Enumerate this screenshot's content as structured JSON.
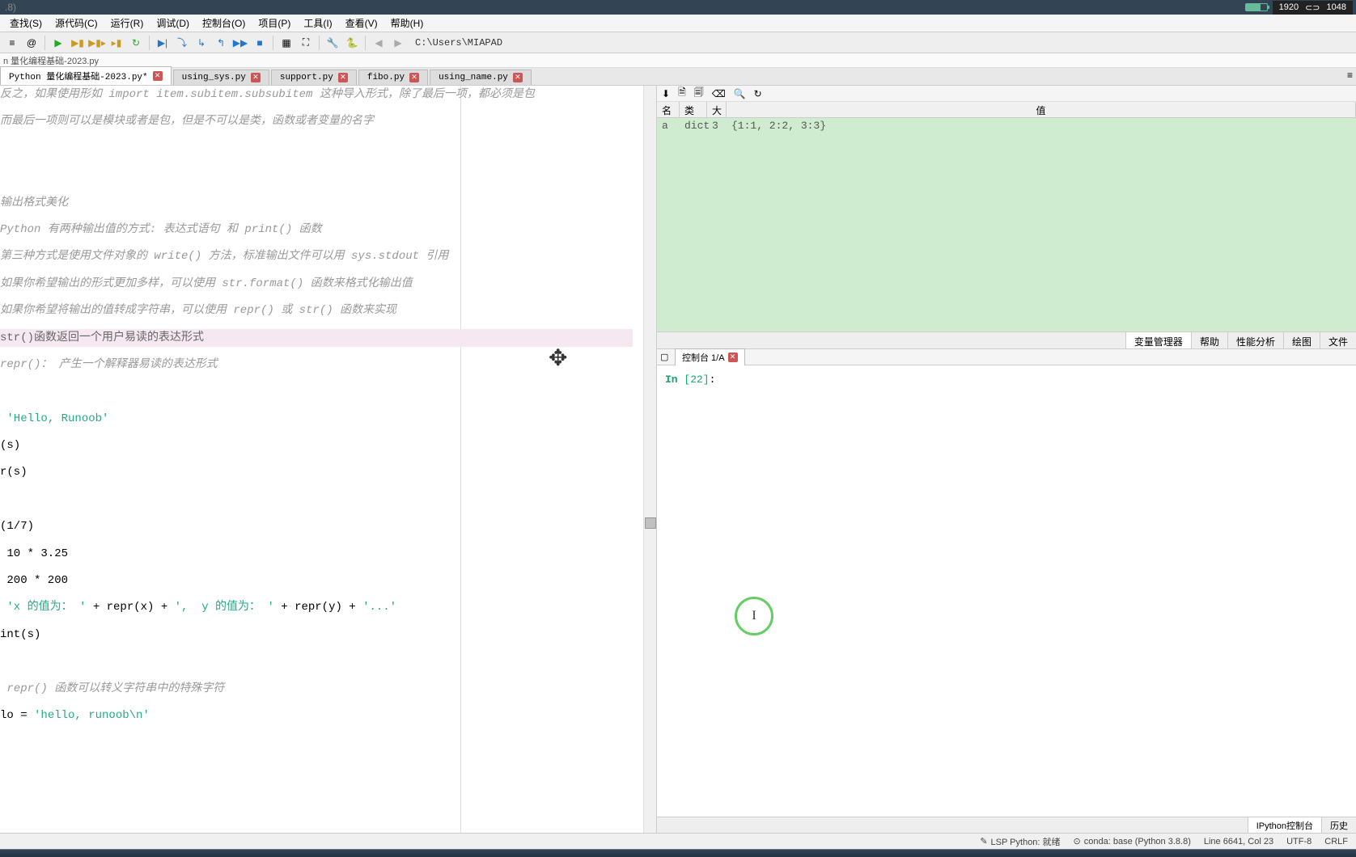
{
  "titlebar": {
    "text": ".8)",
    "resolution_w": "1920",
    "resolution_h": "1048"
  },
  "menu": {
    "find": "查找(S)",
    "source": "源代码(C)",
    "run": "运行(R)",
    "debug": "调试(D)",
    "console": "控制台(O)",
    "project": "项目(P)",
    "tools": "工具(I)",
    "view": "查看(V)",
    "help": "帮助(H)"
  },
  "toolbar": {
    "path": "C:\\Users\\MIAPAD"
  },
  "breadcrumb": "n 量化编程基础-2023.py",
  "tabs": [
    {
      "label": "Python 量化编程基础-2023.py*",
      "active": true
    },
    {
      "label": "using_sys.py",
      "active": false
    },
    {
      "label": "support.py",
      "active": false
    },
    {
      "label": "fibo.py",
      "active": false
    },
    {
      "label": "using_name.py",
      "active": false
    }
  ],
  "editor": {
    "lines": [
      {
        "t": "comment",
        "text": "反之，如果使用形如 import item.subitem.subsubitem 这种导入形式，除了最后一项，都必须是包"
      },
      {
        "t": "comment",
        "text": "而最后一项则可以是模块或者是包，但是不可以是类，函数或者变量的名字"
      },
      {
        "t": "blank"
      },
      {
        "t": "blank"
      },
      {
        "t": "comment",
        "text": "输出格式美化"
      },
      {
        "t": "comment",
        "text": "Python 有两种输出值的方式: 表达式语句 和 print() 函数"
      },
      {
        "t": "comment",
        "text": "第三种方式是使用文件对象的 write() 方法，标准输出文件可以用 sys.stdout 引用"
      },
      {
        "t": "comment",
        "text": "如果你希望输出的形式更加多样，可以使用 str.format() 函数来格式化输出值"
      },
      {
        "t": "comment",
        "text": "如果你希望将输出的值转成字符串，可以使用 repr() 或 str() 函数来实现"
      },
      {
        "t": "highlight",
        "text": "str()函数返回一个用户易读的表达形式"
      },
      {
        "t": "comment",
        "text": "repr()： 产生一个解释器易读的表达形式"
      },
      {
        "t": "blank"
      },
      {
        "t": "code-str",
        "prefix": " ",
        "string": "'Hello, Runoob'"
      },
      {
        "t": "code",
        "text": "(s)"
      },
      {
        "t": "code",
        "text": "r(s)"
      },
      {
        "t": "blank"
      },
      {
        "t": "code",
        "text": "(1/7)"
      },
      {
        "t": "code",
        "text": " 10 * 3.25"
      },
      {
        "t": "code",
        "text": " 200 * 200"
      },
      {
        "t": "code-mix",
        "parts": [
          {
            "k": "plain",
            "v": " "
          },
          {
            "k": "str",
            "v": "'x 的值为： '"
          },
          {
            "k": "plain",
            "v": " + repr(x) + "
          },
          {
            "k": "str",
            "v": "',  y 的值为： '"
          },
          {
            "k": "plain",
            "v": " + repr(y) + "
          },
          {
            "k": "str",
            "v": "'...'"
          }
        ]
      },
      {
        "t": "code",
        "text": "int(s)"
      },
      {
        "t": "blank"
      },
      {
        "t": "comment",
        "text": " repr() 函数可以转义字符串中的特殊字符"
      },
      {
        "t": "code-mix",
        "parts": [
          {
            "k": "plain",
            "v": "lo = "
          },
          {
            "k": "str",
            "v": "'hello, runoob\\n'"
          }
        ]
      }
    ]
  },
  "var_explorer": {
    "headers": {
      "name": "名称",
      "type": "类型",
      "size": "大小",
      "value": "值"
    },
    "rows": [
      {
        "name": "a",
        "type": "dict",
        "size": "3",
        "value": "{1:1, 2:2, 3:3}"
      }
    ],
    "tabs": {
      "var": "变量管理器",
      "help": "帮助",
      "perf": "性能分析",
      "plot": "绘图",
      "file": "文件"
    }
  },
  "console": {
    "tab_label": "控制台 1/A",
    "prompt_label": "In ",
    "prompt_num": "[22]",
    "prompt_colon": ": ",
    "bottom_tabs": {
      "ipython": "IPython控制台",
      "history": "历史"
    }
  },
  "status": {
    "lsp_icon": "✎",
    "lsp": "LSP Python: 就绪",
    "conda_icon": "⊙",
    "conda": "conda: base (Python 3.8.8)",
    "pos": "Line 6641, Col 23",
    "enc": "UTF-8",
    "eol": "CRLF"
  }
}
